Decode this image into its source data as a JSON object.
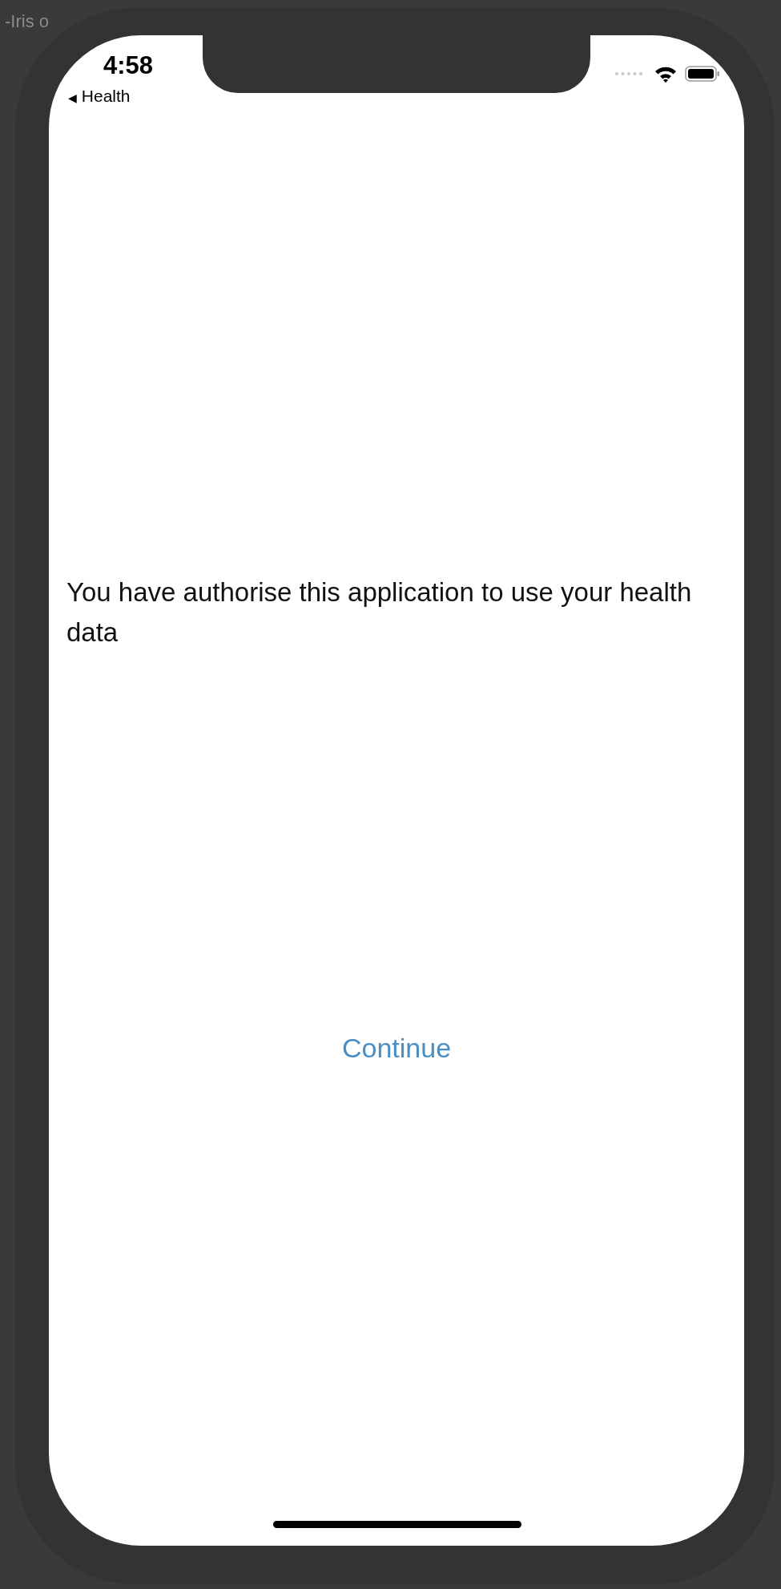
{
  "background": {
    "window_title": "-Iris o"
  },
  "status_bar": {
    "time": "4:58",
    "back_indicator": "◀",
    "back_label": "Health"
  },
  "message": "You have authorise this application to use your health data",
  "continue_button": "Continue"
}
